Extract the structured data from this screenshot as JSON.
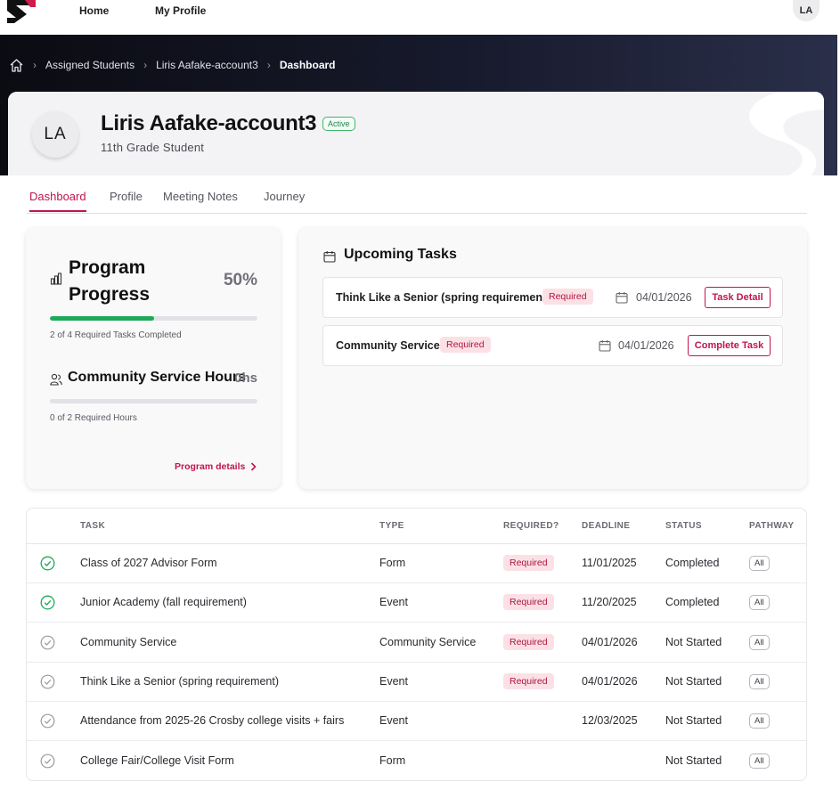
{
  "nav": {
    "home_label": "Home",
    "profile_label": "My Profile",
    "user_initials": "LA"
  },
  "breadcrumb": {
    "items": [
      "Assigned Students",
      "Liris Aafake-account3"
    ],
    "current": "Dashboard"
  },
  "student": {
    "initials": "LA",
    "name": "Liris Aafake-account3",
    "status": "Active",
    "subtitle": "11th Grade Student"
  },
  "tabs": [
    {
      "label": "Dashboard",
      "active": true
    },
    {
      "label": "Profile",
      "active": false
    },
    {
      "label": "Meeting Notes",
      "active": false
    },
    {
      "label": "Journey",
      "active": false
    }
  ],
  "progress": {
    "title": "Program Progress",
    "percent_label": "50%",
    "percent": 50,
    "caption": "2 of 4 Required Tasks Completed",
    "csh_title": "Community Service Hours",
    "csh_value": "0hs",
    "csh_fraction": 0,
    "csh_caption": "0 of 2 Required Hours",
    "details_link": "Program details"
  },
  "upcoming": {
    "title": "Upcoming Tasks",
    "tasks": [
      {
        "name": "Think Like a Senior (spring requirement)",
        "badge": "Required",
        "date": "04/01/2026",
        "action": "Task Detail"
      },
      {
        "name": "Community Service",
        "badge": "Required",
        "date": "04/01/2026",
        "action": "Complete Task"
      }
    ]
  },
  "table": {
    "headers": {
      "task": "TASK",
      "type": "TYPE",
      "required": "REQUIRED?",
      "deadline": "DEADLINE",
      "status": "STATUS",
      "pathway": "PATHWAY"
    },
    "rows": [
      {
        "task": "Class of 2027 Advisor Form",
        "type": "Form",
        "required": "Required",
        "deadline": "11/01/2025",
        "status": "Completed",
        "pathway": "All",
        "done": true
      },
      {
        "task": "Junior Academy (fall requirement)",
        "type": "Event",
        "required": "Required",
        "deadline": "11/20/2025",
        "status": "Completed",
        "pathway": "All",
        "done": true
      },
      {
        "task": "Community Service",
        "type": "Community Service",
        "required": "Required",
        "deadline": "04/01/2026",
        "status": "Not Started",
        "pathway": "All",
        "done": false
      },
      {
        "task": "Think Like a Senior (spring requirement)",
        "type": "Event",
        "required": "Required",
        "deadline": "04/01/2026",
        "status": "Not Started",
        "pathway": "All",
        "done": false
      },
      {
        "task": "Attendance from 2025-26 Crosby college visits + fairs",
        "type": "Event",
        "required": "",
        "deadline": "12/03/2025",
        "status": "Not Started",
        "pathway": "All",
        "done": false
      },
      {
        "task": "College Fair/College Visit Form",
        "type": "Form",
        "required": "",
        "deadline": "",
        "status": "Not Started",
        "pathway": "All",
        "done": false
      }
    ]
  },
  "colors": {
    "accent": "#c0154e",
    "success": "#1eaa5a",
    "hero_dark": "#0b0b12"
  }
}
